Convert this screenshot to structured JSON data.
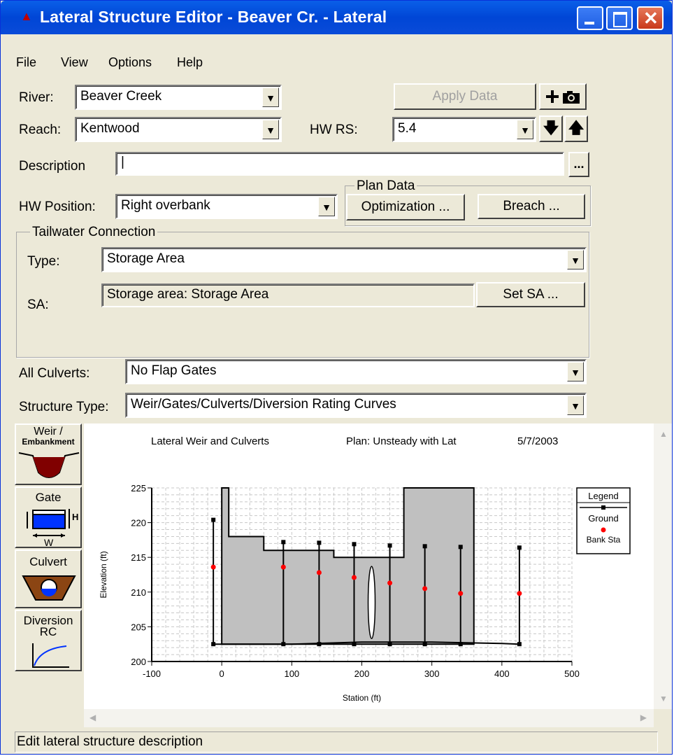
{
  "window": {
    "title": "Lateral Structure Editor - Beaver Cr.  - Lateral"
  },
  "menu": [
    "File",
    "View",
    "Options",
    "Help"
  ],
  "form": {
    "river_label": "River:",
    "river_value": "Beaver Creek",
    "reach_label": "Reach:",
    "reach_value": "Kentwood",
    "hwrs_label": "HW RS:",
    "hwrs_value": "5.4",
    "apply_label": "Apply Data",
    "description_label": "Description",
    "description_value": "|",
    "description_more": "...",
    "hwpos_label": "HW Position:",
    "hwpos_value": "Right overbank",
    "plan_data_title": "Plan Data",
    "optimization_label": "Optimization ...",
    "breach_label": "Breach ...",
    "tw_title": "Tailwater Connection",
    "type_label": "Type:",
    "type_value": "Storage Area",
    "sa_label": "SA:",
    "sa_value": "Storage area: Storage Area",
    "setsa_label": "Set SA ...",
    "culverts_label": "All Culverts:",
    "culverts_value": "No Flap Gates",
    "structtype_label": "Structure Type:",
    "structtype_value": "Weir/Gates/Culverts/Diversion Rating Curves"
  },
  "side_buttons": {
    "weir": [
      "Weir /",
      "Embankment"
    ],
    "gate": "Gate",
    "gate_h": "H",
    "gate_w": "W",
    "culvert": "Culvert",
    "diversion": [
      "Diversion",
      "RC"
    ]
  },
  "status_text": "Edit lateral structure description",
  "chart_data": {
    "type": "line",
    "title": "Lateral Weir and Culverts",
    "plan": "Plan: Unsteady with Lat",
    "date": "5/7/2003",
    "xlabel": "Station (ft)",
    "ylabel": "Elevation (ft)",
    "xlim": [
      -100,
      500
    ],
    "ylim": [
      200,
      225
    ],
    "xticks": [
      "-100",
      "0",
      "100",
      "200",
      "300",
      "400",
      "500"
    ],
    "yticks": [
      "200",
      "205",
      "210",
      "215",
      "220",
      "225"
    ],
    "legend": {
      "title": "Legend",
      "items": [
        "Ground",
        "Bank Sta"
      ]
    },
    "ground": {
      "x": [
        -12,
        0,
        100,
        200,
        300,
        400,
        425
      ],
      "y": [
        202.5,
        202.5,
        202.5,
        202.8,
        202.8,
        202.6,
        202.5
      ]
    },
    "weir": {
      "x": [
        0,
        0,
        10,
        10,
        60,
        60,
        160,
        160,
        260,
        260,
        360,
        360
      ],
      "y": [
        202.5,
        225,
        225,
        218,
        218,
        216,
        216,
        215,
        215,
        225,
        225,
        202.5
      ]
    },
    "poles": [
      {
        "x": -12,
        "top": 220.4,
        "bank": 213.6
      },
      {
        "x": 88,
        "top": 217.2,
        "bank": 213.6
      },
      {
        "x": 139,
        "top": 217.1,
        "bank": 212.8
      },
      {
        "x": 189,
        "top": 216.9,
        "bank": 212.1
      },
      {
        "x": 240,
        "top": 216.7,
        "bank": 211.3
      },
      {
        "x": 290,
        "top": 216.6,
        "bank": 210.5
      },
      {
        "x": 341,
        "top": 216.5,
        "bank": 209.8
      },
      {
        "x": 425,
        "top": 216.4,
        "bank": 209.8
      }
    ],
    "opening": {
      "x": 214,
      "bottom": 203.3,
      "top": 213.7
    }
  }
}
